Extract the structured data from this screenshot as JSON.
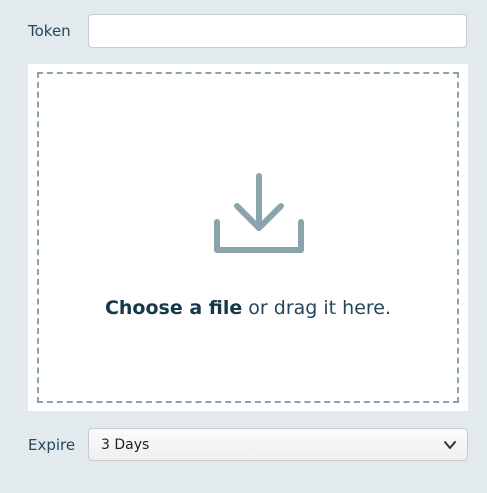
{
  "token": {
    "label": "Token",
    "value": "",
    "placeholder": ""
  },
  "dropzone": {
    "choose_label": "Choose a file",
    "rest_label": " or drag it here.",
    "icon": "download-icon"
  },
  "expire": {
    "label": "Expire",
    "selected": "3 Days",
    "icon": "chevron-down-icon"
  },
  "colors": {
    "background": "#e2eaee",
    "text": "#26475a",
    "icon": "#8aa4ad"
  }
}
